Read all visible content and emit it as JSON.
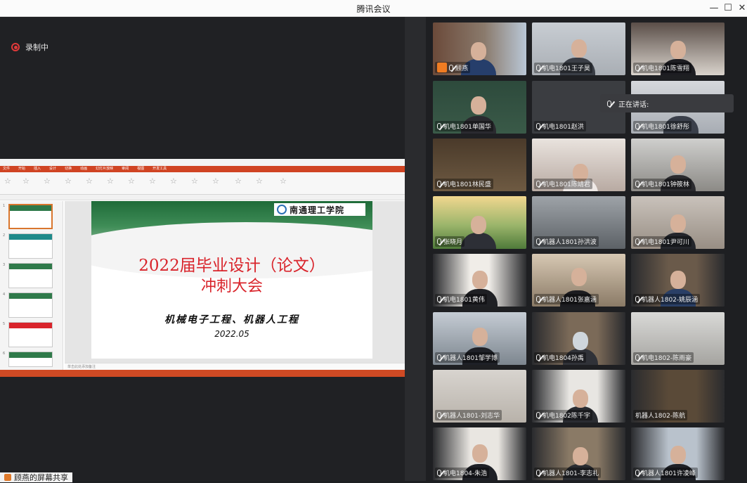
{
  "window": {
    "title": "腾讯会议",
    "controls": {
      "minimize": "—",
      "maximize": "☐",
      "close": "✕"
    }
  },
  "recording": {
    "label": "录制中"
  },
  "ppt": {
    "tabs": [
      "文件",
      "开始",
      "插入",
      "设计",
      "切换",
      "动画",
      "幻灯片放映",
      "审阅",
      "视图",
      "开发工具"
    ],
    "notes_placeholder": "单击此处添加备注"
  },
  "slide": {
    "school": "南通理工学院",
    "title_line1": "2022届毕业设计（论文）",
    "title_line2": "冲刺大会",
    "subtitle": "机械电子工程、机器人工程",
    "date": "2022.05"
  },
  "sharing_bar": {
    "label": "顾燕的屏幕共享"
  },
  "speaking": {
    "label": "正在讲话:"
  },
  "participants": [
    {
      "name": "顾燕",
      "host": true
    },
    {
      "name": "机电1801王子昊"
    },
    {
      "name": "机电1801陈雪翔"
    },
    {
      "name": "机电1801单国华"
    },
    {
      "name": "机电1801赵洪"
    },
    {
      "name": "机电1801徐舒彤"
    },
    {
      "name": "机电1801林民盛"
    },
    {
      "name": "机电1801陈靖君"
    },
    {
      "name": "机电1801钟筱林"
    },
    {
      "name": "张晓月"
    },
    {
      "name": "机器人1801孙洪波"
    },
    {
      "name": "机电1801尹可川"
    },
    {
      "name": "机电1801黄伟"
    },
    {
      "name": "机器人1801张嘉涵"
    },
    {
      "name": "机器人1802-姚辰涵"
    },
    {
      "name": "机器人1801邹学博"
    },
    {
      "name": "机电1804孙禹"
    },
    {
      "name": "机电1802-陈雨豪"
    },
    {
      "name": "机器人1801-刘志华"
    },
    {
      "name": "机电1802陈千宇"
    },
    {
      "name": "机器人1802-陈航"
    },
    {
      "name": "机电1804-朱浩"
    },
    {
      "name": "机器人1801-李志礼"
    },
    {
      "name": "机器人1801许凌峰"
    }
  ]
}
